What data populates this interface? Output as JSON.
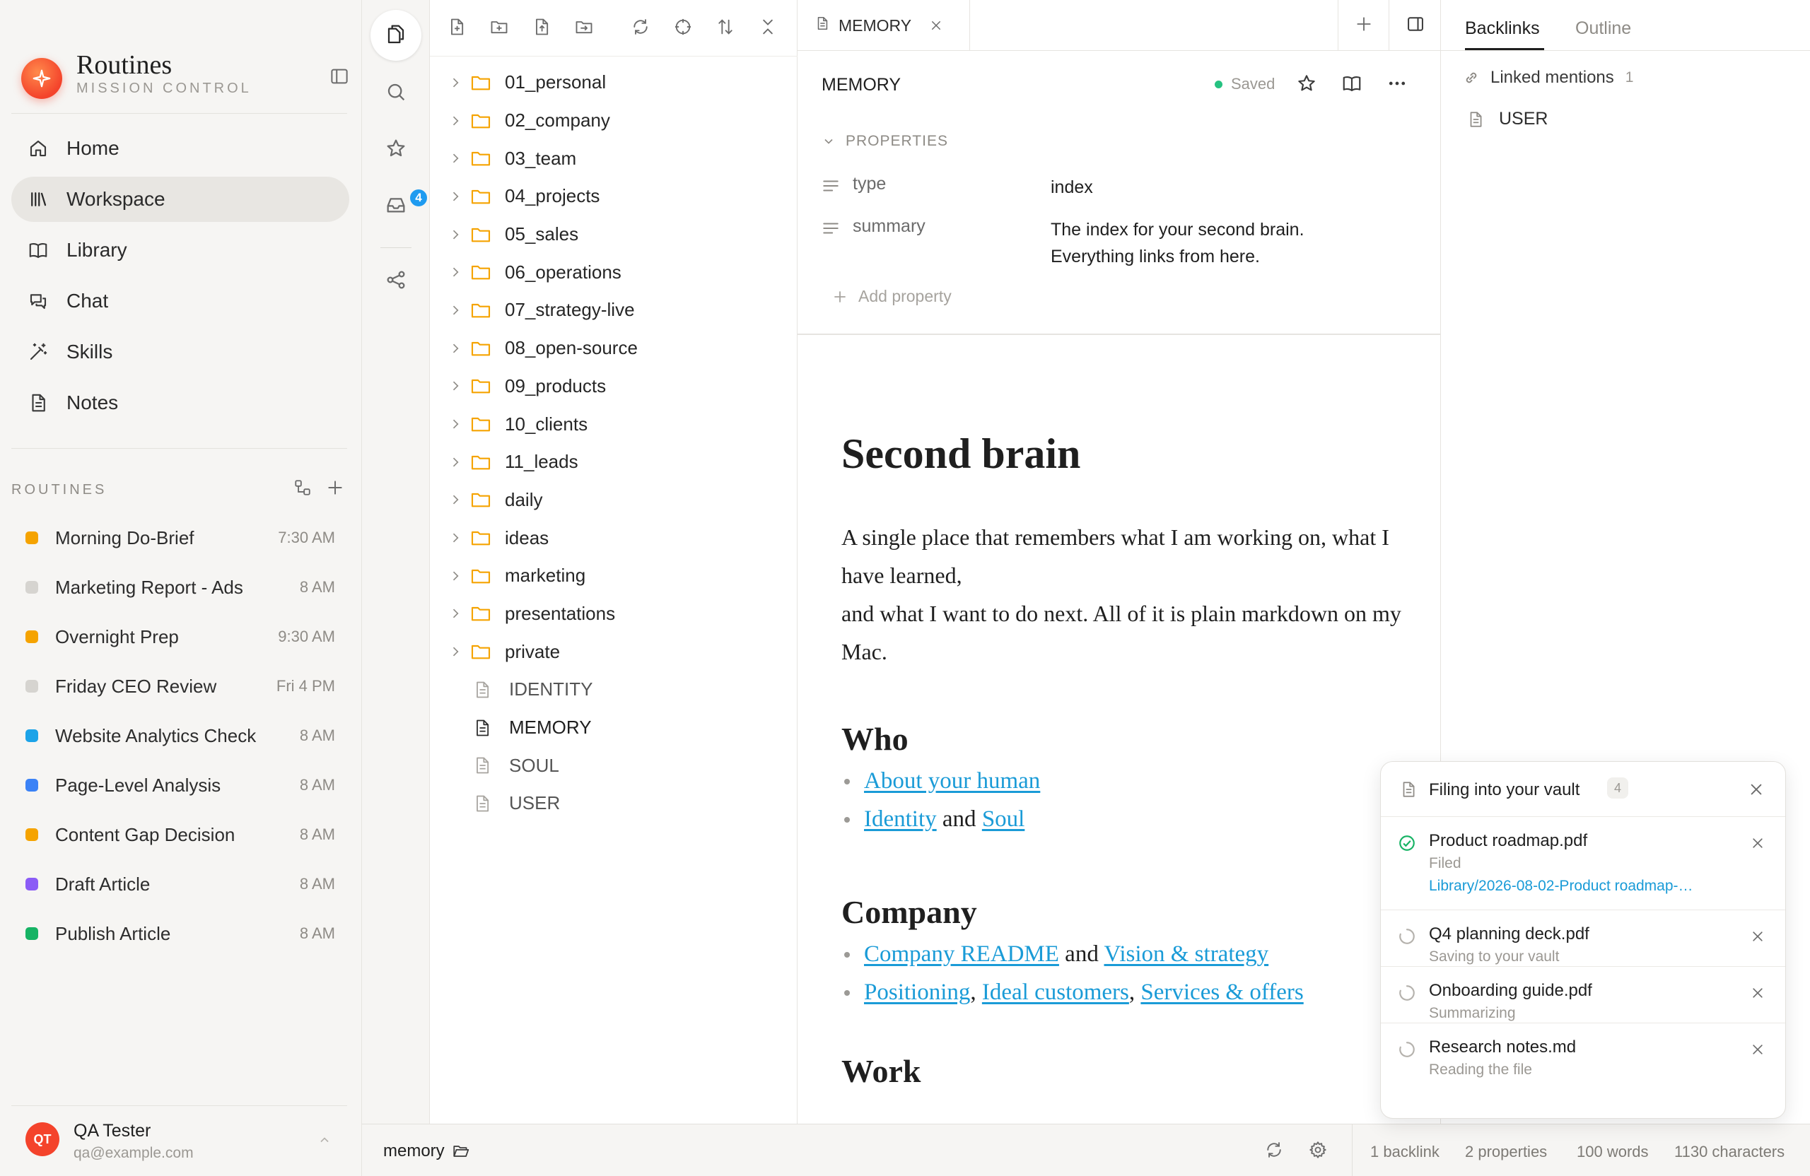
{
  "brand": {
    "title": "Routines",
    "subtitle": "MISSION CONTROL"
  },
  "nav": [
    {
      "label": "Home",
      "icon": "home-icon"
    },
    {
      "label": "Workspace",
      "icon": "library-icon",
      "active": true
    },
    {
      "label": "Library",
      "icon": "book-icon"
    },
    {
      "label": "Chat",
      "icon": "chat-icon"
    },
    {
      "label": "Skills",
      "icon": "wand-icon"
    },
    {
      "label": "Notes",
      "icon": "note-icon"
    }
  ],
  "routines": {
    "heading": "ROUTINES",
    "items": [
      {
        "name": "Morning Do-Brief",
        "time": "7:30 AM",
        "color": "#f5a300"
      },
      {
        "name": "Marketing Report - Ads",
        "time": "8 AM",
        "color": "#d6d4d0"
      },
      {
        "name": "Overnight Prep",
        "time": "9:30 AM",
        "color": "#f5a300"
      },
      {
        "name": "Friday CEO Review",
        "time": "Fri 4 PM",
        "color": "#d6d4d0"
      },
      {
        "name": "Website Analytics Check",
        "time": "8 AM",
        "color": "#1ca3e8"
      },
      {
        "name": "Page-Level Analysis",
        "time": "8 AM",
        "color": "#3b82f6"
      },
      {
        "name": "Content Gap Decision",
        "time": "8 AM",
        "color": "#f5a300"
      },
      {
        "name": "Draft Article",
        "time": "8 AM",
        "color": "#8b5cf6"
      },
      {
        "name": "Publish Article",
        "time": "8 AM",
        "color": "#16b364"
      }
    ]
  },
  "user": {
    "initials": "QT",
    "name": "QA Tester",
    "email": "qa@example.com"
  },
  "rail": {
    "inbox_badge": "4"
  },
  "tree": {
    "folders": [
      "01_personal",
      "02_company",
      "03_team",
      "04_projects",
      "05_sales",
      "06_operations",
      "07_strategy-live",
      "08_open-source",
      "09_products",
      "10_clients",
      "11_leads",
      "daily",
      "ideas",
      "marketing",
      "presentations",
      "private"
    ],
    "files": [
      "IDENTITY",
      "MEMORY",
      "SOUL",
      "USER"
    ],
    "current_file": "MEMORY"
  },
  "editor": {
    "tab_label": "MEMORY",
    "doc_title": "MEMORY",
    "saved_label": "Saved",
    "properties": {
      "heading": "PROPERTIES",
      "items": [
        {
          "key": "type",
          "value": "index"
        },
        {
          "key": "summary",
          "value_line1": "The index for your second brain.",
          "value_line2": "Everything links from here."
        }
      ],
      "add_label": "Add property"
    },
    "content": {
      "h1": "Second brain",
      "intro_line1": "A single place that remembers what I am working on, what I have learned,",
      "intro_line2": "and what I want to do next. All of it is plain markdown on my Mac.",
      "who": {
        "heading": "Who",
        "link1": "About your human",
        "link2": "Identity",
        "and": "and",
        "link3": "Soul"
      },
      "company": {
        "heading": "Company",
        "link1": "Company README",
        "and": "and",
        "link2": "Vision & strategy",
        "link3": "Positioning",
        "link4": "Ideal customers",
        "link5": "Services & offers",
        "comma": ","
      },
      "work_heading": "Work"
    }
  },
  "right_panel": {
    "tabs": [
      "Backlinks",
      "Outline"
    ],
    "linked_mentions": "Linked mentions",
    "linked_count": "1",
    "backlinks": [
      "USER"
    ]
  },
  "status_bar": {
    "path": "memory",
    "backlinks": "1 backlink",
    "properties": "2 properties",
    "words": "100 words",
    "characters": "1130 characters"
  },
  "toast": {
    "title": "Filing into your vault",
    "count": "4",
    "jobs": [
      {
        "name": "Product roadmap.pdf",
        "status": "Filed",
        "link": "Library/2026-08-02-Product roadmap-…",
        "done": true
      },
      {
        "name": "Q4 planning deck.pdf",
        "status": "Saving to your vault"
      },
      {
        "name": "Onboarding guide.pdf",
        "status": "Summarizing"
      },
      {
        "name": "Research notes.md",
        "status": "Reading the file"
      }
    ]
  }
}
